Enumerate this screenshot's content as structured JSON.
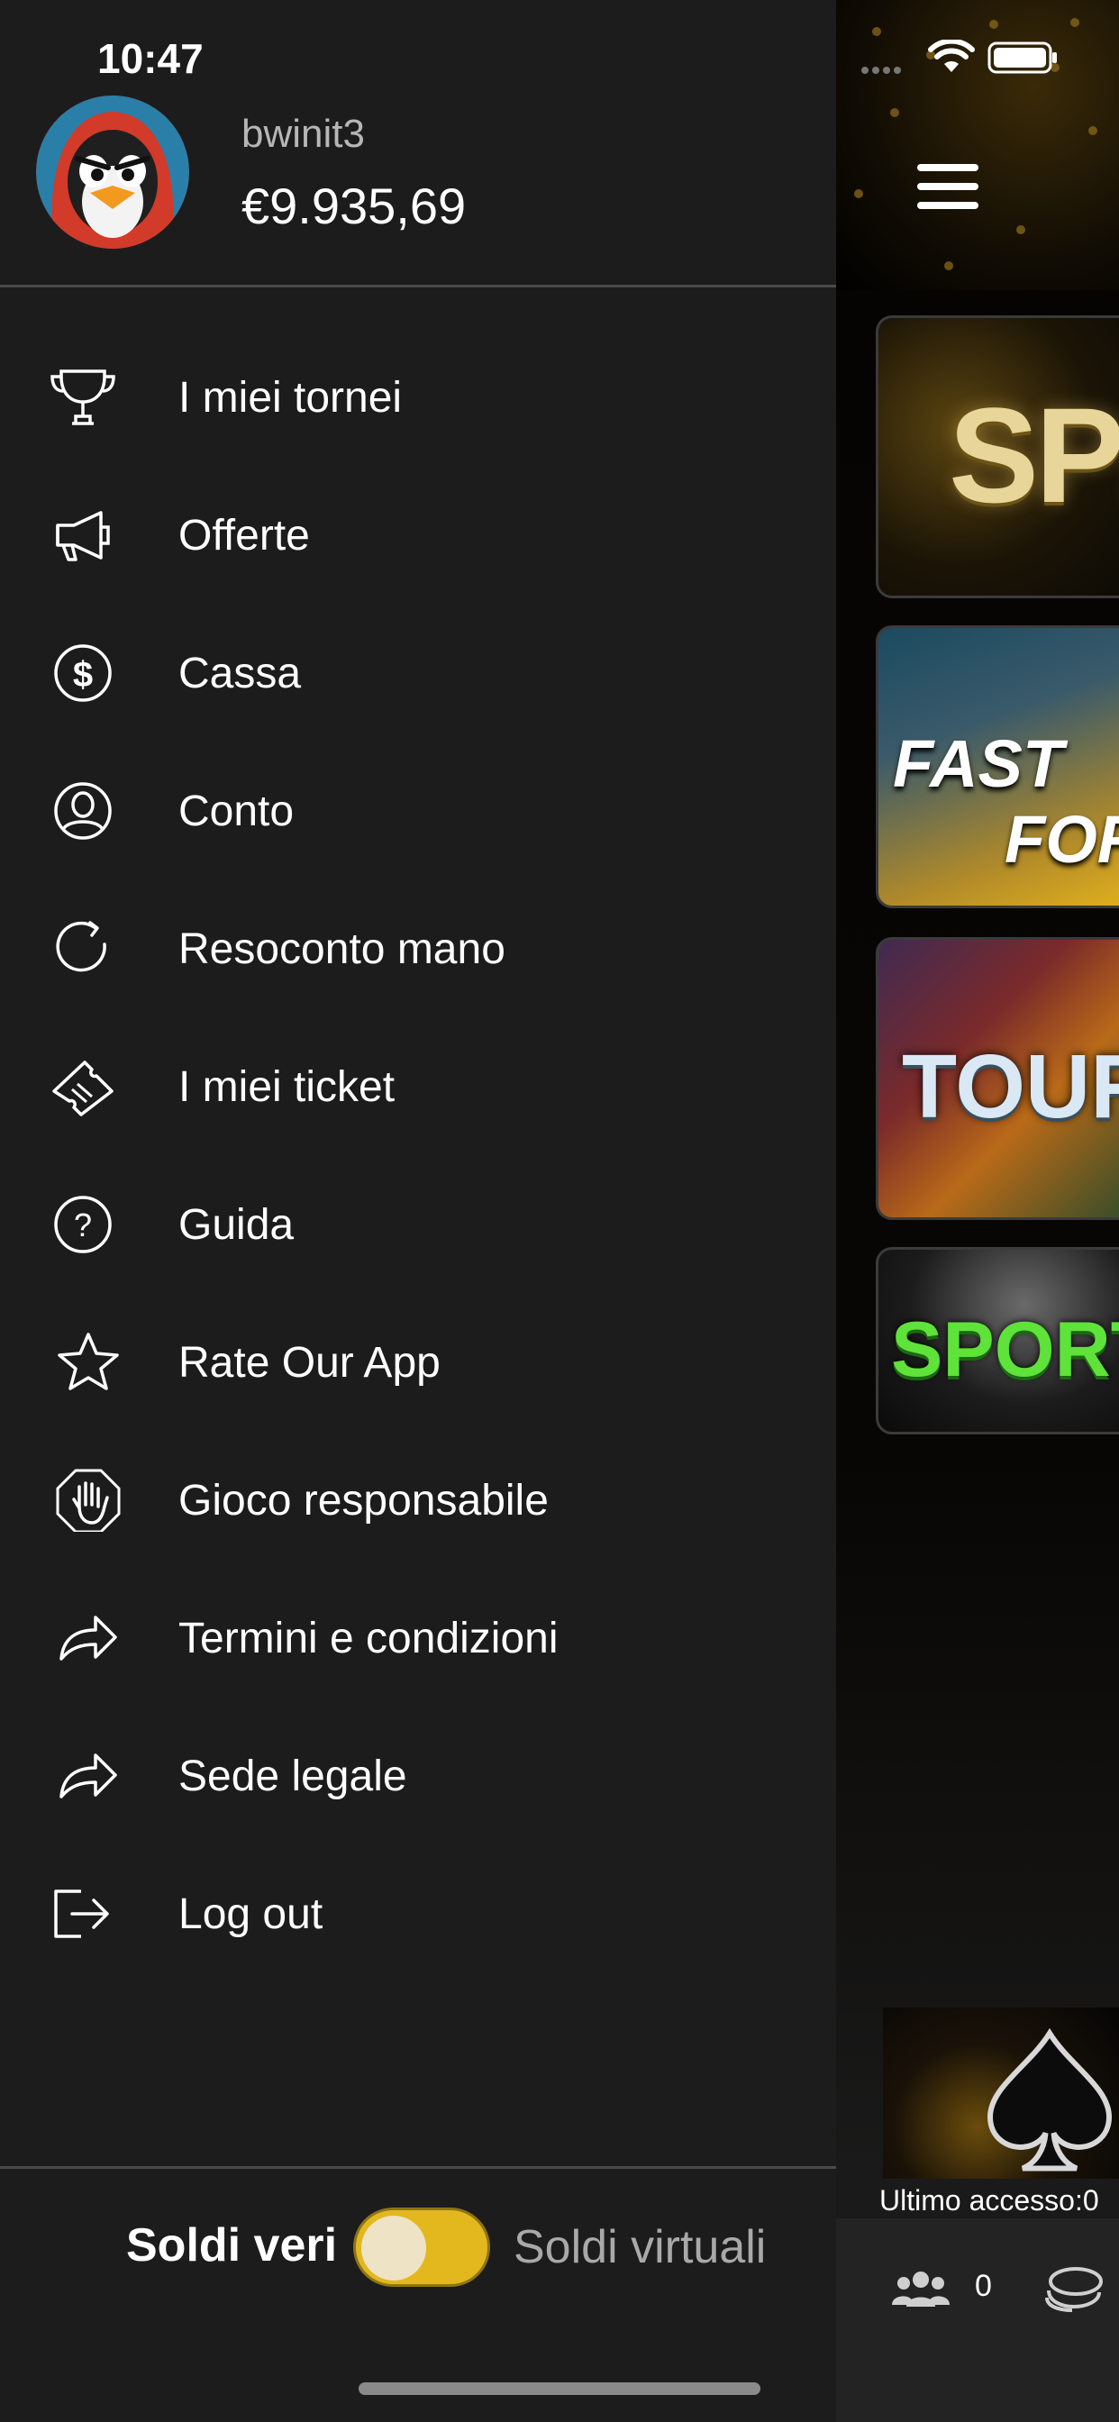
{
  "status_bar": {
    "time": "10:47"
  },
  "profile": {
    "username": "bwinit3",
    "balance": "€9.935,69",
    "avatar_icon": "penguin-avatar"
  },
  "menu": {
    "items": [
      {
        "label": "I miei tornei",
        "icon": "trophy-icon"
      },
      {
        "label": "Offerte",
        "icon": "megaphone-icon"
      },
      {
        "label": "Cassa",
        "icon": "dollar-icon"
      },
      {
        "label": "Conto",
        "icon": "user-icon"
      },
      {
        "label": "Resoconto mano",
        "icon": "refresh-icon"
      },
      {
        "label": "I miei ticket",
        "icon": "ticket-icon"
      },
      {
        "label": "Guida",
        "icon": "help-icon"
      },
      {
        "label": "Rate Our App",
        "icon": "star-icon"
      },
      {
        "label": "Gioco responsabile",
        "icon": "hand-stop-icon"
      },
      {
        "label": "Termini e condizioni",
        "icon": "share-arrow-icon"
      },
      {
        "label": "Sede legale",
        "icon": "share-arrow-icon"
      },
      {
        "label": "Log out",
        "icon": "logout-icon"
      }
    ]
  },
  "money_mode": {
    "real_label": "Soldi veri",
    "virtual_label": "Soldi virtuali",
    "toggle_state": "real"
  },
  "lobby": {
    "tiles": [
      {
        "label": "SPI"
      },
      {
        "label_line1": "FAST",
        "label_line2": "FOR"
      },
      {
        "label": "TOUR"
      },
      {
        "label": "SPORT"
      }
    ],
    "last_access": "Ultimo accesso:0",
    "players_count": "0"
  },
  "colors": {
    "drawer_bg": "#1c1c1d",
    "toggle_accent": "#e3b81e",
    "divider": "#4a4a4a"
  }
}
